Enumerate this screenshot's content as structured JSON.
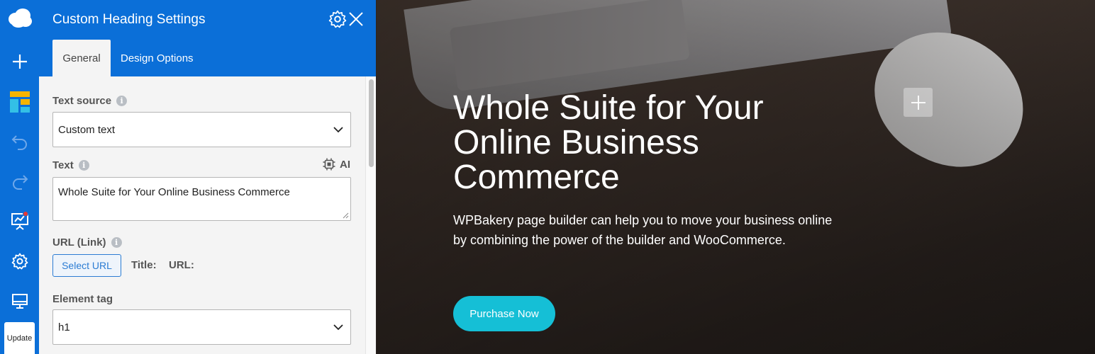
{
  "toolbar": {
    "items": [
      {
        "icon": "cloud-logo-icon"
      },
      {
        "icon": "add-element-icon"
      },
      {
        "icon": "templates-icon"
      },
      {
        "icon": "undo-icon"
      },
      {
        "icon": "redo-icon"
      },
      {
        "icon": "seo-analytics-icon",
        "has_notification": true
      },
      {
        "icon": "settings-icon"
      },
      {
        "icon": "responsive-preview-icon"
      }
    ],
    "update_label": "Update"
  },
  "panel": {
    "title": "Custom Heading Settings",
    "tabs": [
      {
        "label": "General",
        "active": true
      },
      {
        "label": "Design Options",
        "active": false
      }
    ],
    "fields": {
      "text_source": {
        "label": "Text source",
        "value": "Custom text"
      },
      "text": {
        "label": "Text",
        "value": "Whole Suite for Your Online Business Commerce",
        "ai_label": "AI"
      },
      "url": {
        "label": "URL (Link)",
        "button_label": "Select URL",
        "title_label": "Title:",
        "url_label": "URL:"
      },
      "element_tag": {
        "label": "Element tag",
        "value": "h1"
      }
    }
  },
  "hero": {
    "title": "Whole Suite for Your Online Business Commerce",
    "description": "WPBakery page builder can help you to move your business online by combining the power of the builder and WooCommerce.",
    "cta_label": "Purchase Now"
  },
  "colors": {
    "toolbar_blue": "#0b6fd8",
    "cta_teal": "#15bfd6",
    "notification_red": "#e53935"
  }
}
